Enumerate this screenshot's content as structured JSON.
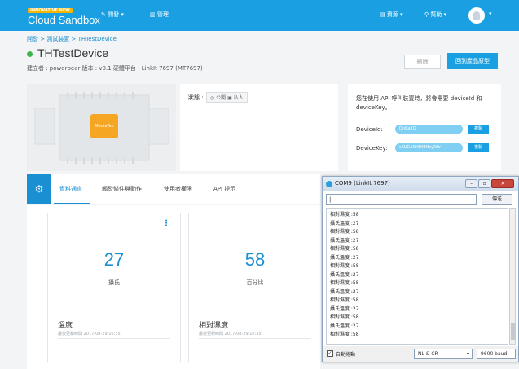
{
  "header": {
    "badge": "INNOVATIVE NEW",
    "brand": "Cloud Sandbox",
    "nav_dev": "開發",
    "nav_manage": "管理",
    "nav_resources": "資源",
    "nav_help": "幫助"
  },
  "breadcrumb": "開發 > 測試裝置 > THTestDevice",
  "device": {
    "name": "THTestDevice",
    "meta": "建立者 : powerbear    版本 : v0.1    硬體平台 : LinkIt 7697 (MT7697)",
    "delete_label": "刪除",
    "template_label": "回到產品原型"
  },
  "board": {
    "chip_label": "MediaTek"
  },
  "status": {
    "label": "狀態 :",
    "public": "公開",
    "private": "私人"
  },
  "api": {
    "hint": "您在使用 API 呼叫裝置時，將會需要 deviceId 和 deviceKey。",
    "id_label": "DeviceId:",
    "id_value": "Dn8aXQ",
    "key_label": "DeviceKey:",
    "key_value": "sKUGaNHDf3HcyNbr",
    "copy_label": "複製"
  },
  "tabs": [
    "資料通道",
    "觸發條件與動作",
    "使用者權限",
    "API 提示"
  ],
  "cards": [
    {
      "value": "27",
      "unit": "攝氏",
      "name": "溫度",
      "time": "最後更新時間 2017-08-29 16:35"
    },
    {
      "value": "58",
      "unit": "百分比",
      "name": "相對濕度",
      "time": "最後更新時間 2017-08-29 16:35"
    }
  ],
  "com": {
    "title": "COM9 (LinkIt 7697)",
    "send": "傳送",
    "lines": [
      "相對濕度 :58",
      "攝氏溫度 :27",
      "相對濕度 :58",
      "攝氏溫度 :27",
      "相對濕度 :58",
      "攝氏溫度 :27",
      "相對濕度 :58",
      "攝氏溫度 :27",
      "相對濕度 :58",
      "攝氏溫度 :27",
      "相對濕度 :58",
      "攝氏溫度 :27",
      "相對濕度 :58",
      "攝氏溫度 :27",
      "相對濕度 :58"
    ],
    "autoscroll": "自動捲動",
    "line_ending": "NL & CR",
    "baud": "9600 baud"
  },
  "colors": {
    "brand": "#1aa0e2",
    "accent": "#1a8fd1",
    "online": "#3cb54a"
  }
}
